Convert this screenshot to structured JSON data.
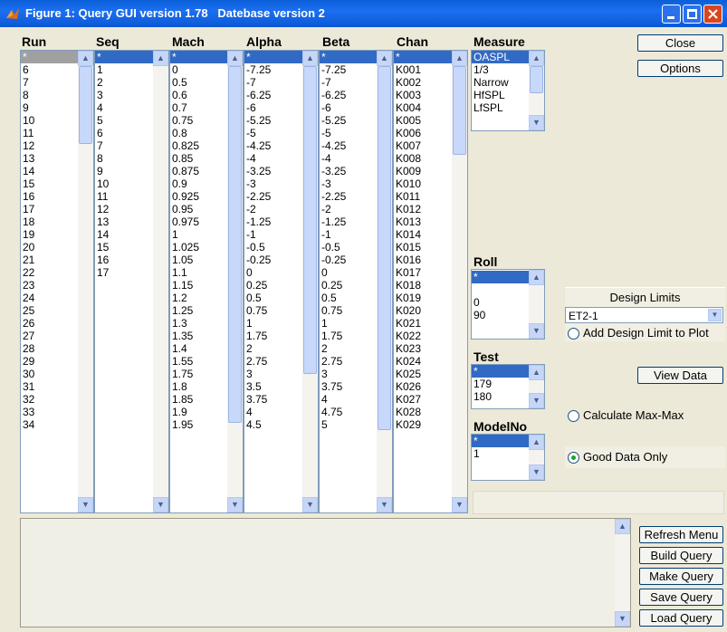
{
  "window": {
    "title": "Figure 1: Query GUI version 1.78   Datebase version 2"
  },
  "columns": {
    "run": {
      "header": "Run",
      "items": [
        "*",
        "6",
        "7",
        "8",
        "9",
        "10",
        "11",
        "12",
        "13",
        "14",
        "15",
        "16",
        "17",
        "18",
        "19",
        "20",
        "21",
        "22",
        "23",
        "24",
        "25",
        "26",
        "27",
        "28",
        "29",
        "30",
        "31",
        "32",
        "33",
        "34"
      ]
    },
    "seq": {
      "header": "Seq",
      "items": [
        "*",
        "1",
        "2",
        "3",
        "4",
        "5",
        "6",
        "7",
        "8",
        "9",
        "10",
        "11",
        "12",
        "13",
        "14",
        "15",
        "16",
        "17"
      ]
    },
    "mach": {
      "header": "Mach",
      "items": [
        "*",
        "0",
        "0.5",
        "0.6",
        "0.7",
        "0.75",
        "0.8",
        "0.825",
        "0.85",
        "0.875",
        "0.9",
        "0.925",
        "0.95",
        "0.975",
        "1",
        "1.025",
        "1.05",
        "1.1",
        "1.15",
        "1.2",
        "1.25",
        "1.3",
        "1.35",
        "1.4",
        "1.55",
        "1.75",
        "1.8",
        "1.85",
        "1.9",
        "1.95"
      ]
    },
    "alpha": {
      "header": "Alpha",
      "items": [
        "*",
        "-7.25",
        "-7",
        "-6.25",
        "-6",
        "-5.25",
        "-5",
        "-4.25",
        "-4",
        "-3.25",
        "-3",
        "-2.25",
        "-2",
        "-1.25",
        "-1",
        "-0.5",
        "-0.25",
        "0",
        "0.25",
        "0.5",
        "0.75",
        "1",
        "1.75",
        "2",
        "2.75",
        "3",
        "3.5",
        "3.75",
        "4",
        "4.5"
      ]
    },
    "beta": {
      "header": "Beta",
      "items": [
        "*",
        "-7.25",
        "-7",
        "-6.25",
        "-6",
        "-5.25",
        "-5",
        "-4.25",
        "-4",
        "-3.25",
        "-3",
        "-2.25",
        "-2",
        "-1.25",
        "-1",
        "-0.5",
        "-0.25",
        "0",
        "0.25",
        "0.5",
        "0.75",
        "1",
        "1.75",
        "2",
        "2.75",
        "3",
        "3.75",
        "4",
        "4.75",
        "5"
      ]
    },
    "chan": {
      "header": "Chan",
      "items": [
        "*",
        "K001",
        "K002",
        "K003",
        "K004",
        "K005",
        "K006",
        "K007",
        "K008",
        "K009",
        "K010",
        "K011",
        "K012",
        "K013",
        "K014",
        "K015",
        "K016",
        "K017",
        "K018",
        "K019",
        "K020",
        "K021",
        "K022",
        "K023",
        "K024",
        "K025",
        "K026",
        "K027",
        "K028",
        "K029"
      ]
    }
  },
  "measure": {
    "header": "Measure",
    "items": [
      "OASPL",
      "1/3",
      "Narrow",
      "HfSPL",
      "LfSPL"
    ]
  },
  "roll": {
    "header": "Roll",
    "items": [
      "*",
      "",
      "0",
      "90"
    ]
  },
  "test": {
    "header": "Test",
    "items": [
      "*",
      "179",
      "180"
    ]
  },
  "modelno": {
    "header": "ModelNo",
    "items": [
      "*",
      "1"
    ]
  },
  "design_limits": {
    "label": "Design Limits",
    "selected": "ET2-1",
    "add_label": "Add Design Limit to Plot"
  },
  "buttons": {
    "close": "Close",
    "options": "Options",
    "view_data": "View Data",
    "refresh_menu": "Refresh Menu",
    "build_query": "Build Query",
    "make_query": "Make Query",
    "save_query": "Save Query",
    "load_query": "Load Query"
  },
  "options": {
    "calc_maxmax": {
      "label": "Calculate Max-Max",
      "checked": false
    },
    "good_data": {
      "label": "Good Data Only",
      "checked": true
    },
    "add_design_limit": {
      "checked": false
    }
  },
  "colors": {
    "title_bar": "#0b5fd7",
    "selection": "#316ac5",
    "window_bg": "#ece9d8"
  }
}
